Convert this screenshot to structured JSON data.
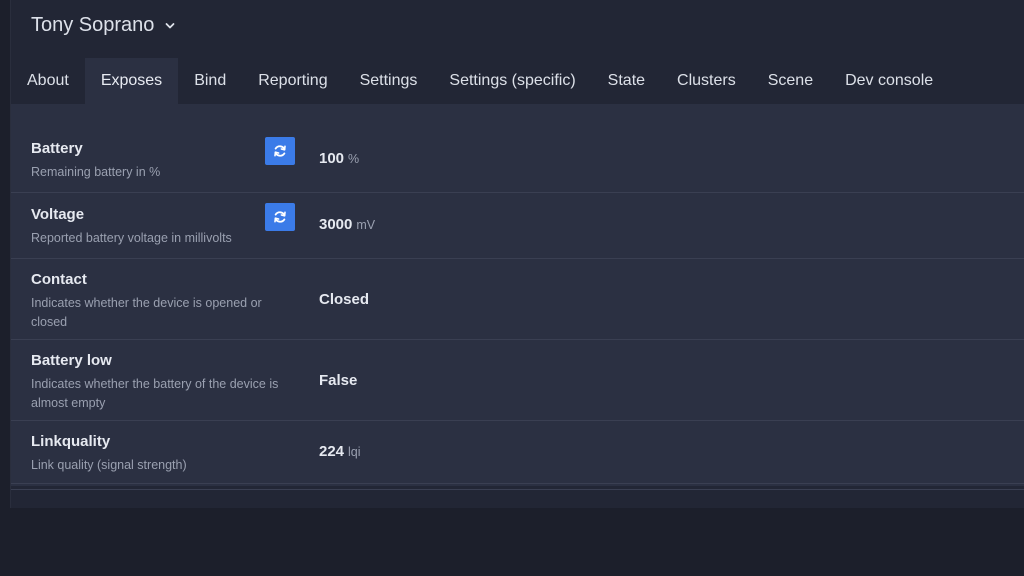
{
  "device": {
    "name": "Tony Soprano"
  },
  "tabs": [
    {
      "label": "About",
      "active": false
    },
    {
      "label": "Exposes",
      "active": true
    },
    {
      "label": "Bind",
      "active": false
    },
    {
      "label": "Reporting",
      "active": false
    },
    {
      "label": "Settings",
      "active": false
    },
    {
      "label": "Settings (specific)",
      "active": false
    },
    {
      "label": "State",
      "active": false
    },
    {
      "label": "Clusters",
      "active": false
    },
    {
      "label": "Scene",
      "active": false
    },
    {
      "label": "Dev console",
      "active": false
    }
  ],
  "exposes": [
    {
      "title": "Battery",
      "description": "Remaining battery in %",
      "value": "100",
      "unit": "%",
      "refresh": true
    },
    {
      "title": "Voltage",
      "description": "Reported battery voltage in millivolts",
      "value": "3000",
      "unit": "mV",
      "refresh": true
    },
    {
      "title": "Contact",
      "description": "Indicates whether the device is opened or closed",
      "value": "Closed",
      "unit": "",
      "refresh": false
    },
    {
      "title": "Battery low",
      "description": "Indicates whether the battery of the device is almost empty",
      "value": "False",
      "unit": "",
      "refresh": false
    },
    {
      "title": "Linkquality",
      "description": "Link quality (signal strength)",
      "value": "224",
      "unit": "lqi",
      "refresh": false
    }
  ],
  "colors": {
    "accent": "#3b7be8",
    "background": "#1c1f2b",
    "panel": "#2b3042"
  },
  "icons": {
    "header_dropdown": "chevron-down-icon",
    "refresh": "refresh-icon"
  }
}
